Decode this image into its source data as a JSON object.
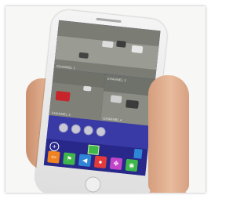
{
  "image": {
    "alt": "Hand holding a smartphone showing a four-channel security camera viewer app"
  },
  "app": {
    "channels": [
      {
        "label": "CHANNEL 1"
      },
      {
        "label": "CHANNEL 2"
      },
      {
        "label": "CHANNEL 3"
      },
      {
        "label": "CHANNEL 4"
      }
    ],
    "toolbar_icons": [
      {
        "name": "exit-icon",
        "color": "#f0821f"
      },
      {
        "name": "flag-icon",
        "color": "#3fb64a"
      },
      {
        "name": "speaker-icon",
        "color": "#2f86d6"
      },
      {
        "name": "microphone-icon",
        "color": "#e13b3b"
      },
      {
        "name": "ptz-icon",
        "color": "#c245c9"
      },
      {
        "name": "camera-icon",
        "color": "#3fb64a"
      }
    ],
    "colors": {
      "screen_bg": "#2c2a8a",
      "accent": "#3a3aa6"
    }
  }
}
